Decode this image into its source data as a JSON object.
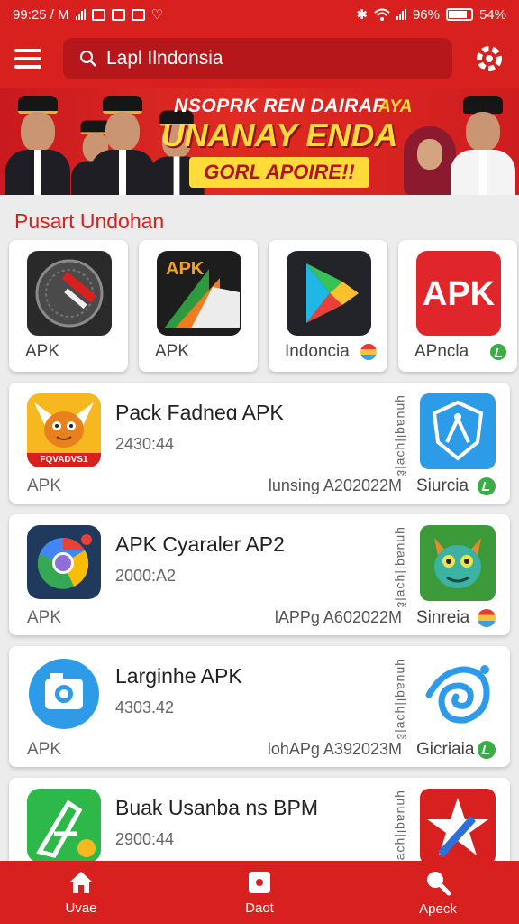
{
  "status_bar": {
    "time": "99:25 / M",
    "battery_text": "96%",
    "extra_text": "54%"
  },
  "header": {
    "search_value": "Lapl Ilndonsia"
  },
  "banner": {
    "line1": "NSOPRK REN DAIRAF",
    "line1b": "AYA",
    "line2": "UNANAY ENDA",
    "line3": "GORL APOIRE!!"
  },
  "section": {
    "title": "Pusart Undohan"
  },
  "categories": [
    {
      "label": "APK",
      "icon": "record-icon"
    },
    {
      "label": "APK",
      "icon": "apk-folder-icon"
    },
    {
      "label": "Indoncia",
      "icon": "play-store-icon"
    },
    {
      "label": "APncla",
      "icon": "apk-red-icon"
    }
  ],
  "apps": [
    {
      "name": "Pack Fadneɑ APK",
      "size": "2430:44",
      "type": "APK",
      "meta": "lunsing A202022M",
      "vertical": "ɥnuaql|ɥɔɐ|ɛ̃",
      "side_label": "Siurcia",
      "icon": "mascot-icon",
      "icon_caption": "FQVADVS1",
      "side_icon": "shield-icon"
    },
    {
      "name": "APK Cyaraler AP2",
      "size": "2000:A2",
      "type": "APK",
      "meta": "lAPPg A602022M",
      "vertical": "ɥnuaql|ɥɔɐ|ɛ̃",
      "side_label": "Sinreia",
      "icon": "chrome-icon",
      "side_icon": "dragon-icon"
    },
    {
      "name": "Larginhe APK",
      "size": "4303.42",
      "type": "APK",
      "meta": "lohAPg A392023M",
      "vertical": "ɥnuaql|ɥɔɐ|ɛ̃",
      "side_label": "Gicriaia",
      "icon": "camera-icon",
      "side_icon": "swirl-icon"
    },
    {
      "name": "Buak Usanba ns BPM",
      "size": "2900:44",
      "type": "",
      "meta": "",
      "vertical": "ɥnuaql|ɥɔɐ|ɛ̃",
      "side_label": "",
      "icon": "green-app-icon",
      "side_icon": "star-icon"
    }
  ],
  "bottom_nav": [
    {
      "label": "Uvae",
      "icon": "home-icon"
    },
    {
      "label": "Daot",
      "icon": "box-icon"
    },
    {
      "label": "Apeck",
      "icon": "search-icon"
    }
  ],
  "colors": {
    "brand_red": "#d8201f",
    "search_red": "#b5171a",
    "banner_yellow": "#ffdc3a"
  }
}
